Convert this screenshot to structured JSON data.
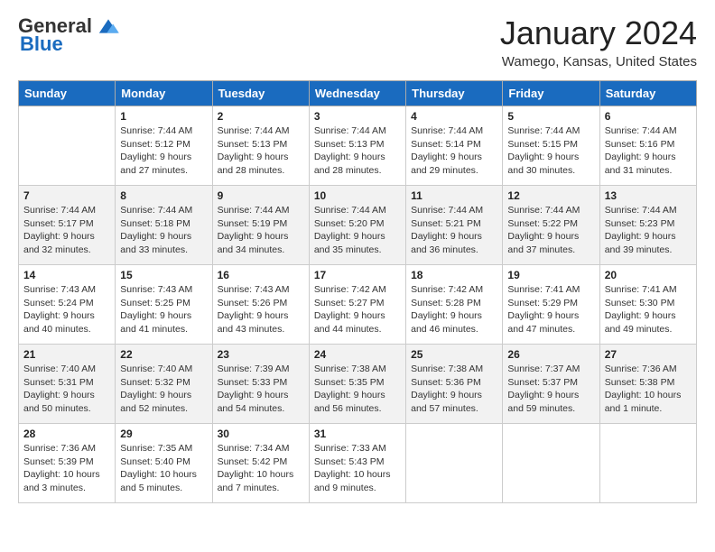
{
  "logo": {
    "general": "General",
    "blue": "Blue"
  },
  "title": "January 2024",
  "location": "Wamego, Kansas, United States",
  "days_of_week": [
    "Sunday",
    "Monday",
    "Tuesday",
    "Wednesday",
    "Thursday",
    "Friday",
    "Saturday"
  ],
  "weeks": [
    [
      {
        "day": "",
        "sunrise": "",
        "sunset": "",
        "daylight": ""
      },
      {
        "day": "1",
        "sunrise": "Sunrise: 7:44 AM",
        "sunset": "Sunset: 5:12 PM",
        "daylight": "Daylight: 9 hours and 27 minutes."
      },
      {
        "day": "2",
        "sunrise": "Sunrise: 7:44 AM",
        "sunset": "Sunset: 5:13 PM",
        "daylight": "Daylight: 9 hours and 28 minutes."
      },
      {
        "day": "3",
        "sunrise": "Sunrise: 7:44 AM",
        "sunset": "Sunset: 5:13 PM",
        "daylight": "Daylight: 9 hours and 28 minutes."
      },
      {
        "day": "4",
        "sunrise": "Sunrise: 7:44 AM",
        "sunset": "Sunset: 5:14 PM",
        "daylight": "Daylight: 9 hours and 29 minutes."
      },
      {
        "day": "5",
        "sunrise": "Sunrise: 7:44 AM",
        "sunset": "Sunset: 5:15 PM",
        "daylight": "Daylight: 9 hours and 30 minutes."
      },
      {
        "day": "6",
        "sunrise": "Sunrise: 7:44 AM",
        "sunset": "Sunset: 5:16 PM",
        "daylight": "Daylight: 9 hours and 31 minutes."
      }
    ],
    [
      {
        "day": "7",
        "sunrise": "Sunrise: 7:44 AM",
        "sunset": "Sunset: 5:17 PM",
        "daylight": "Daylight: 9 hours and 32 minutes."
      },
      {
        "day": "8",
        "sunrise": "Sunrise: 7:44 AM",
        "sunset": "Sunset: 5:18 PM",
        "daylight": "Daylight: 9 hours and 33 minutes."
      },
      {
        "day": "9",
        "sunrise": "Sunrise: 7:44 AM",
        "sunset": "Sunset: 5:19 PM",
        "daylight": "Daylight: 9 hours and 34 minutes."
      },
      {
        "day": "10",
        "sunrise": "Sunrise: 7:44 AM",
        "sunset": "Sunset: 5:20 PM",
        "daylight": "Daylight: 9 hours and 35 minutes."
      },
      {
        "day": "11",
        "sunrise": "Sunrise: 7:44 AM",
        "sunset": "Sunset: 5:21 PM",
        "daylight": "Daylight: 9 hours and 36 minutes."
      },
      {
        "day": "12",
        "sunrise": "Sunrise: 7:44 AM",
        "sunset": "Sunset: 5:22 PM",
        "daylight": "Daylight: 9 hours and 37 minutes."
      },
      {
        "day": "13",
        "sunrise": "Sunrise: 7:44 AM",
        "sunset": "Sunset: 5:23 PM",
        "daylight": "Daylight: 9 hours and 39 minutes."
      }
    ],
    [
      {
        "day": "14",
        "sunrise": "Sunrise: 7:43 AM",
        "sunset": "Sunset: 5:24 PM",
        "daylight": "Daylight: 9 hours and 40 minutes."
      },
      {
        "day": "15",
        "sunrise": "Sunrise: 7:43 AM",
        "sunset": "Sunset: 5:25 PM",
        "daylight": "Daylight: 9 hours and 41 minutes."
      },
      {
        "day": "16",
        "sunrise": "Sunrise: 7:43 AM",
        "sunset": "Sunset: 5:26 PM",
        "daylight": "Daylight: 9 hours and 43 minutes."
      },
      {
        "day": "17",
        "sunrise": "Sunrise: 7:42 AM",
        "sunset": "Sunset: 5:27 PM",
        "daylight": "Daylight: 9 hours and 44 minutes."
      },
      {
        "day": "18",
        "sunrise": "Sunrise: 7:42 AM",
        "sunset": "Sunset: 5:28 PM",
        "daylight": "Daylight: 9 hours and 46 minutes."
      },
      {
        "day": "19",
        "sunrise": "Sunrise: 7:41 AM",
        "sunset": "Sunset: 5:29 PM",
        "daylight": "Daylight: 9 hours and 47 minutes."
      },
      {
        "day": "20",
        "sunrise": "Sunrise: 7:41 AM",
        "sunset": "Sunset: 5:30 PM",
        "daylight": "Daylight: 9 hours and 49 minutes."
      }
    ],
    [
      {
        "day": "21",
        "sunrise": "Sunrise: 7:40 AM",
        "sunset": "Sunset: 5:31 PM",
        "daylight": "Daylight: 9 hours and 50 minutes."
      },
      {
        "day": "22",
        "sunrise": "Sunrise: 7:40 AM",
        "sunset": "Sunset: 5:32 PM",
        "daylight": "Daylight: 9 hours and 52 minutes."
      },
      {
        "day": "23",
        "sunrise": "Sunrise: 7:39 AM",
        "sunset": "Sunset: 5:33 PM",
        "daylight": "Daylight: 9 hours and 54 minutes."
      },
      {
        "day": "24",
        "sunrise": "Sunrise: 7:38 AM",
        "sunset": "Sunset: 5:35 PM",
        "daylight": "Daylight: 9 hours and 56 minutes."
      },
      {
        "day": "25",
        "sunrise": "Sunrise: 7:38 AM",
        "sunset": "Sunset: 5:36 PM",
        "daylight": "Daylight: 9 hours and 57 minutes."
      },
      {
        "day": "26",
        "sunrise": "Sunrise: 7:37 AM",
        "sunset": "Sunset: 5:37 PM",
        "daylight": "Daylight: 9 hours and 59 minutes."
      },
      {
        "day": "27",
        "sunrise": "Sunrise: 7:36 AM",
        "sunset": "Sunset: 5:38 PM",
        "daylight": "Daylight: 10 hours and 1 minute."
      }
    ],
    [
      {
        "day": "28",
        "sunrise": "Sunrise: 7:36 AM",
        "sunset": "Sunset: 5:39 PM",
        "daylight": "Daylight: 10 hours and 3 minutes."
      },
      {
        "day": "29",
        "sunrise": "Sunrise: 7:35 AM",
        "sunset": "Sunset: 5:40 PM",
        "daylight": "Daylight: 10 hours and 5 minutes."
      },
      {
        "day": "30",
        "sunrise": "Sunrise: 7:34 AM",
        "sunset": "Sunset: 5:42 PM",
        "daylight": "Daylight: 10 hours and 7 minutes."
      },
      {
        "day": "31",
        "sunrise": "Sunrise: 7:33 AM",
        "sunset": "Sunset: 5:43 PM",
        "daylight": "Daylight: 10 hours and 9 minutes."
      },
      {
        "day": "",
        "sunrise": "",
        "sunset": "",
        "daylight": ""
      },
      {
        "day": "",
        "sunrise": "",
        "sunset": "",
        "daylight": ""
      },
      {
        "day": "",
        "sunrise": "",
        "sunset": "",
        "daylight": ""
      }
    ]
  ]
}
